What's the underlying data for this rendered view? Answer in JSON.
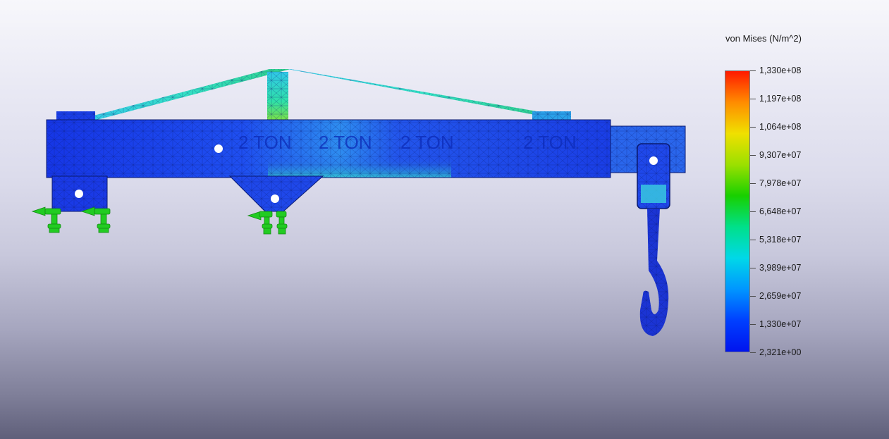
{
  "legend": {
    "title": "von Mises (N/m^2)",
    "labels": [
      "1,330e+08",
      "1,197e+08",
      "1,064e+08",
      "9,307e+07",
      "7,978e+07",
      "6,648e+07",
      "5,318e+07",
      "3,989e+07",
      "2,659e+07",
      "1,330e+07",
      "2,321e+00"
    ],
    "gradient_colors": [
      "#ff1a00",
      "#ff8c00",
      "#f0e000",
      "#9be000",
      "#18d000",
      "#00e08a",
      "#00d8e8",
      "#0096ff",
      "#0040ff",
      "#0014ee"
    ]
  },
  "model": {
    "beam_text": "2 TON"
  },
  "colors": {
    "mesh_low": "#1a2fe0",
    "mesh_mid": "#18b8e8",
    "fixture": "#22cc22"
  }
}
